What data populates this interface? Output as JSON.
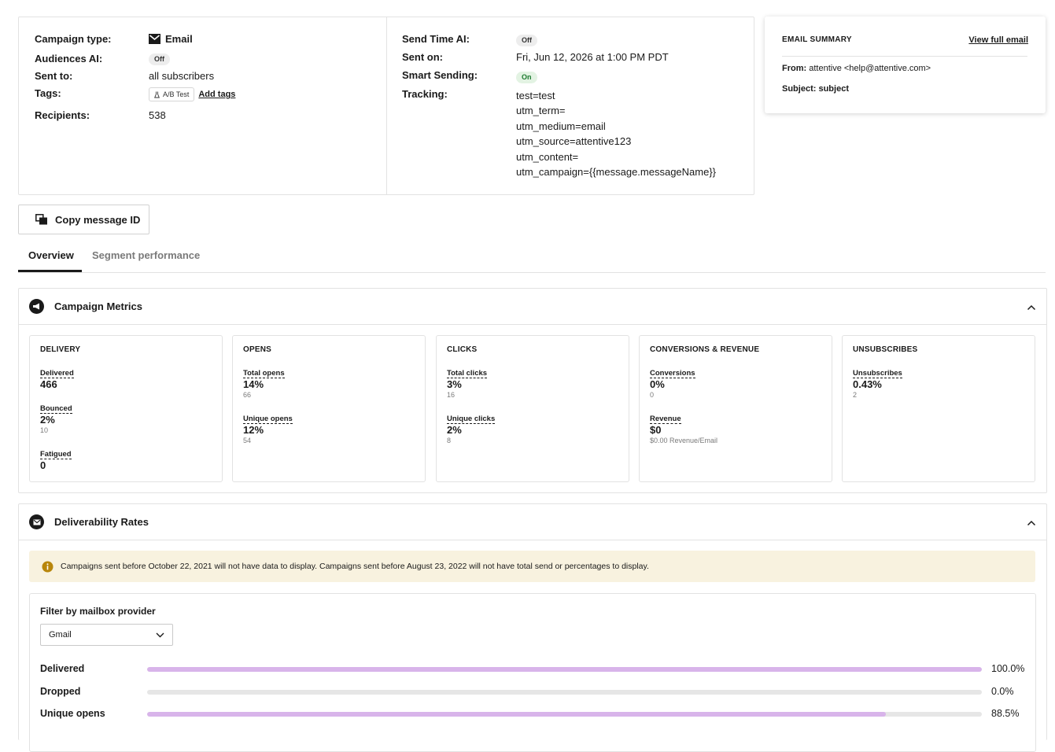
{
  "details": {
    "left": [
      {
        "label": "Campaign type:",
        "value": "Email"
      },
      {
        "label": "Audiences AI:",
        "value": "Off"
      },
      {
        "label": "Sent to:",
        "value": "all subscribers"
      },
      {
        "label": "Tags:",
        "tag": "A/B Test",
        "add_link": "Add tags"
      },
      {
        "label": "Recipients:",
        "value": "538"
      }
    ],
    "right": [
      {
        "label": "Send Time AI:",
        "value": "Off"
      },
      {
        "label": "Sent on:",
        "value": "Fri, Jun 12, 2026 at 1:00 PM PDT"
      },
      {
        "label": "Smart Sending:",
        "value": "On"
      },
      {
        "label": "Tracking:",
        "lines": [
          "test=test",
          "utm_term=",
          "utm_medium=email",
          "utm_source=attentive123",
          "utm_content=",
          "utm_campaign={{message.messageName}}"
        ]
      }
    ]
  },
  "summary": {
    "title": "EMAIL SUMMARY",
    "link": "View full email",
    "from_label": "From:",
    "from_value": "attentive <help@attentive.com>",
    "subject_label": "Subject:",
    "subject_value": "subject"
  },
  "copy_button": "Copy message ID",
  "tabs": [
    {
      "label": "Overview",
      "active": true
    },
    {
      "label": "Segment performance",
      "active": false
    }
  ],
  "campaign_metrics": {
    "title": "Campaign Metrics",
    "cards": [
      {
        "title": "DELIVERY",
        "metrics": [
          {
            "label": "Delivered",
            "value": "466",
            "sub": ""
          },
          {
            "label": "Bounced",
            "value": "2%",
            "sub": "10"
          },
          {
            "label": "Fatigued",
            "value": "0",
            "sub": ""
          }
        ]
      },
      {
        "title": "OPENS",
        "metrics": [
          {
            "label": "Total opens",
            "value": "14%",
            "sub": "66"
          },
          {
            "label": "Unique opens",
            "value": "12%",
            "sub": "54"
          }
        ]
      },
      {
        "title": "CLICKS",
        "metrics": [
          {
            "label": "Total clicks",
            "value": "3%",
            "sub": "16"
          },
          {
            "label": "Unique clicks",
            "value": "2%",
            "sub": "8"
          }
        ]
      },
      {
        "title": "CONVERSIONS & REVENUE",
        "metrics": [
          {
            "label": "Conversions",
            "value": "0%",
            "sub": "0"
          },
          {
            "label": "Revenue",
            "value": "$0",
            "sub": "$0.00 Revenue/Email"
          }
        ]
      },
      {
        "title": "UNSUBSCRIBES",
        "metrics": [
          {
            "label": "Unsubscribes",
            "value": "0.43%",
            "sub": "2"
          }
        ]
      }
    ]
  },
  "deliverability": {
    "title": "Deliverability Rates",
    "notice": "Campaigns sent before October 22, 2021 will not have data to display. Campaigns sent before August 23, 2022 will not have total send or percentages to display.",
    "filter_label": "Filter by mailbox provider",
    "filter_value": "Gmail",
    "rates": [
      {
        "label": "Delivered",
        "value": "100.0%",
        "fraction": 1.0
      },
      {
        "label": "Dropped",
        "value": "0.0%",
        "fraction": 0.0
      },
      {
        "label": "Unique opens",
        "value": "88.5%",
        "fraction": 0.885
      }
    ],
    "bar_color": "#d8b4ea"
  }
}
